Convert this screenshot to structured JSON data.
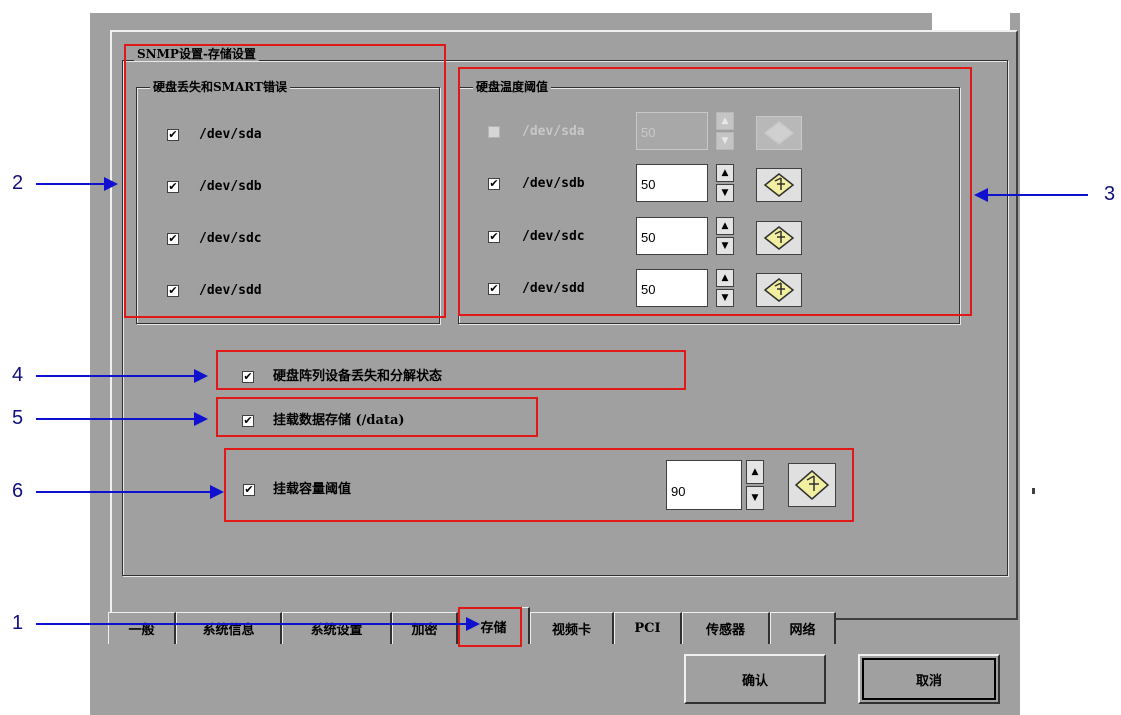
{
  "snmp_group": {
    "legend": "SNMP设置-存储设置"
  },
  "disk_loss": {
    "legend": "硬盘丢失和SMART错误",
    "items": [
      {
        "label": "/dev/sda",
        "checked": true
      },
      {
        "label": "/dev/sdb",
        "checked": true
      },
      {
        "label": "/dev/sdc",
        "checked": true
      },
      {
        "label": "/dev/sdd",
        "checked": true
      }
    ]
  },
  "disk_temp": {
    "legend": "硬盘温度阈值",
    "items": [
      {
        "label": "/dev/sda",
        "checked": false,
        "enabled": false,
        "value": "50"
      },
      {
        "label": "/dev/sdb",
        "checked": true,
        "enabled": true,
        "value": "50"
      },
      {
        "label": "/dev/sdc",
        "checked": true,
        "enabled": true,
        "value": "50"
      },
      {
        "label": "/dev/sdd",
        "checked": true,
        "enabled": true,
        "value": "50"
      }
    ]
  },
  "raid": {
    "label": "硬盘阵列设备丢失和分解状态",
    "checked": true
  },
  "mount": {
    "label": "挂载数据存储 (/data)",
    "checked": true
  },
  "capacity": {
    "label": "挂载容量阈值",
    "checked": true,
    "value": "90"
  },
  "tabs": [
    {
      "label": "一般",
      "active": false
    },
    {
      "label": "系统信息",
      "active": false
    },
    {
      "label": "系统设置",
      "active": false
    },
    {
      "label": "加密",
      "active": false
    },
    {
      "label": "存储",
      "active": true
    },
    {
      "label": "视频卡",
      "active": false
    },
    {
      "label": "PCI",
      "active": false
    },
    {
      "label": "传感器",
      "active": false
    },
    {
      "label": "网络",
      "active": false
    }
  ],
  "buttons": {
    "ok": "确认",
    "cancel": "取消"
  },
  "callouts": {
    "c1": "1",
    "c2": "2",
    "c3": "3",
    "c4": "4",
    "c5": "5",
    "c6": "6"
  },
  "glyphs": {
    "check": "✔",
    "up": "▲",
    "down": "▼"
  },
  "colors": {
    "window_bg": "#a0a0a0",
    "annotation_red": "#e01818",
    "annotation_blue": "#1010d0"
  }
}
